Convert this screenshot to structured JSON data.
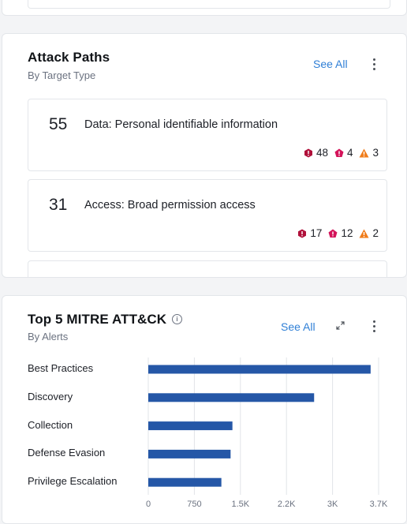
{
  "attack_paths": {
    "title": "Attack Paths",
    "subtitle": "By Target Type",
    "see_all": "See All",
    "items": [
      {
        "count": "55",
        "label": "Data: Personal identifiable information",
        "critical": "48",
        "high": "4",
        "medium": "3"
      },
      {
        "count": "31",
        "label": "Access: Broad permission access",
        "critical": "17",
        "high": "12",
        "medium": "2"
      }
    ]
  },
  "mitre": {
    "title": "Top 5 MITRE ATT&CK",
    "subtitle": "By Alerts",
    "see_all": "See All",
    "info_icon": "i"
  },
  "colors": {
    "bar": "#2557a7",
    "link": "#2f7fd6",
    "critical": "#b0103a",
    "high": "#d4145a",
    "medium": "#f07c1a"
  },
  "icons": [
    "kebab-menu-icon",
    "info-icon",
    "expand-icon",
    "critical-hexagon-icon",
    "high-pentagon-icon",
    "medium-triangle-icon"
  ],
  "chart_data": {
    "type": "bar",
    "orientation": "horizontal",
    "title": "Top 5 MITRE ATT&CK",
    "subtitle": "By Alerts",
    "categories": [
      "Best Practices",
      "Discovery",
      "Collection",
      "Defense Evasion",
      "Privilege Escalation"
    ],
    "values": [
      3620,
      2700,
      1370,
      1340,
      1190
    ],
    "xlim": [
      0,
      3750
    ],
    "xticks": [
      "0",
      "750",
      "1.5K",
      "2.2K",
      "3K",
      "3.7K"
    ],
    "grid": true
  }
}
